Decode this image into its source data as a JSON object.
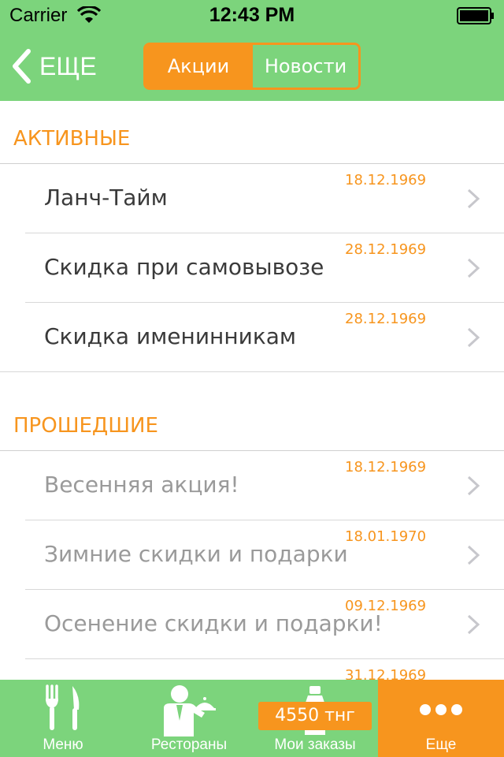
{
  "status_bar": {
    "carrier": "Carrier",
    "time": "12:43 PM"
  },
  "nav": {
    "back_label": "ЕЩЕ",
    "segments": [
      {
        "label": "Акции",
        "active": true
      },
      {
        "label": "Новости",
        "active": false
      }
    ]
  },
  "sections": [
    {
      "title": "АКТИВНЫЕ",
      "items": [
        {
          "title": "Ланч-Тайм",
          "date": "18.12.1969"
        },
        {
          "title": "Скидка при самовывозе",
          "date": "28.12.1969"
        },
        {
          "title": "Скидка именинникам",
          "date": "28.12.1969"
        }
      ]
    },
    {
      "title": "ПРОШЕДШИЕ",
      "items": [
        {
          "title": "Весенняя акция!",
          "date": "18.12.1969"
        },
        {
          "title": "Зимние скидки и подарки",
          "date": "18.01.1970"
        },
        {
          "title": "Осенение скидки и подарки!",
          "date": "09.12.1969"
        },
        {
          "title": "",
          "date": "31.12.1969"
        }
      ]
    }
  ],
  "tabbar": {
    "tabs": [
      {
        "label": "Меню",
        "icon": "fork-knife-icon",
        "active": false
      },
      {
        "label": "Рестораны",
        "icon": "waiter-icon",
        "active": false
      },
      {
        "label": "Мои заказы",
        "icon": "bottle-icon",
        "active": false,
        "badge": "4550 тнг"
      },
      {
        "label": "Еще",
        "icon": "more-dots-icon",
        "active": true
      }
    ]
  },
  "colors": {
    "green": "#7cd47c",
    "orange": "#f7951e",
    "text_dark": "#3a3a3a",
    "text_muted": "#9a9a9a"
  }
}
